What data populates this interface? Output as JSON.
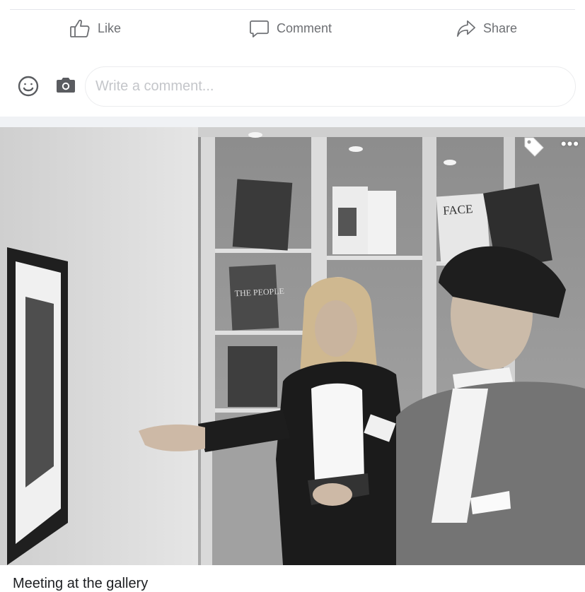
{
  "actions": {
    "like_label": "Like",
    "comment_label": "Comment",
    "share_label": "Share"
  },
  "composer": {
    "placeholder": "Write a comment...",
    "emoji_icon": "smiley-icon",
    "camera_icon": "camera-icon"
  },
  "photo": {
    "tag_icon": "tag-icon",
    "more_label": "•••",
    "book_title_face": "FACE",
    "book_title_people": "THE PEOPLE"
  },
  "caption": {
    "text": "Meeting at the gallery"
  },
  "colors": {
    "divider": "#e4e6eb",
    "action_text": "#6d6f73",
    "background_band": "#f0f2f5"
  }
}
